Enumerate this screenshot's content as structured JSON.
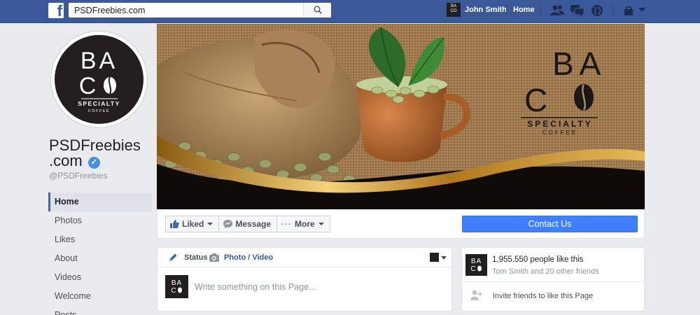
{
  "topbar": {
    "logo_letter": "f",
    "search_value": "PSDFreebies.com",
    "user_name": "John Smith",
    "home_label": "Home"
  },
  "page": {
    "name_line1": "PSDFreebies",
    "name_line2": ".com",
    "handle": "@PSDFreebies"
  },
  "brand": {
    "letters_row1": "BA",
    "letter_row2": "C",
    "tagline": "SPECIALTY",
    "subtagline": "COFFEE",
    "dark": "#231f20"
  },
  "sidebar": {
    "items": [
      {
        "label": "Home"
      },
      {
        "label": "Photos"
      },
      {
        "label": "Likes"
      },
      {
        "label": "About"
      },
      {
        "label": "Videos"
      },
      {
        "label": "Welcome"
      },
      {
        "label": "Posts"
      }
    ]
  },
  "actions": {
    "liked_label": "Liked",
    "message_label": "Message",
    "more_label": "More",
    "contact_label": "Contact Us"
  },
  "composer": {
    "status_label": "Status",
    "photo_label": "Photo / Video",
    "placeholder": "Write something on this Page..."
  },
  "likes_box": {
    "count_text": "1,955.550 people like this",
    "friends_text": "Tom Smith and 20 other friends",
    "invite_text": "Invite friends to like this Page"
  },
  "colors": {
    "facebook_blue": "#3b5998",
    "contact_button": "#4080ff",
    "gold": "#c8962e"
  }
}
